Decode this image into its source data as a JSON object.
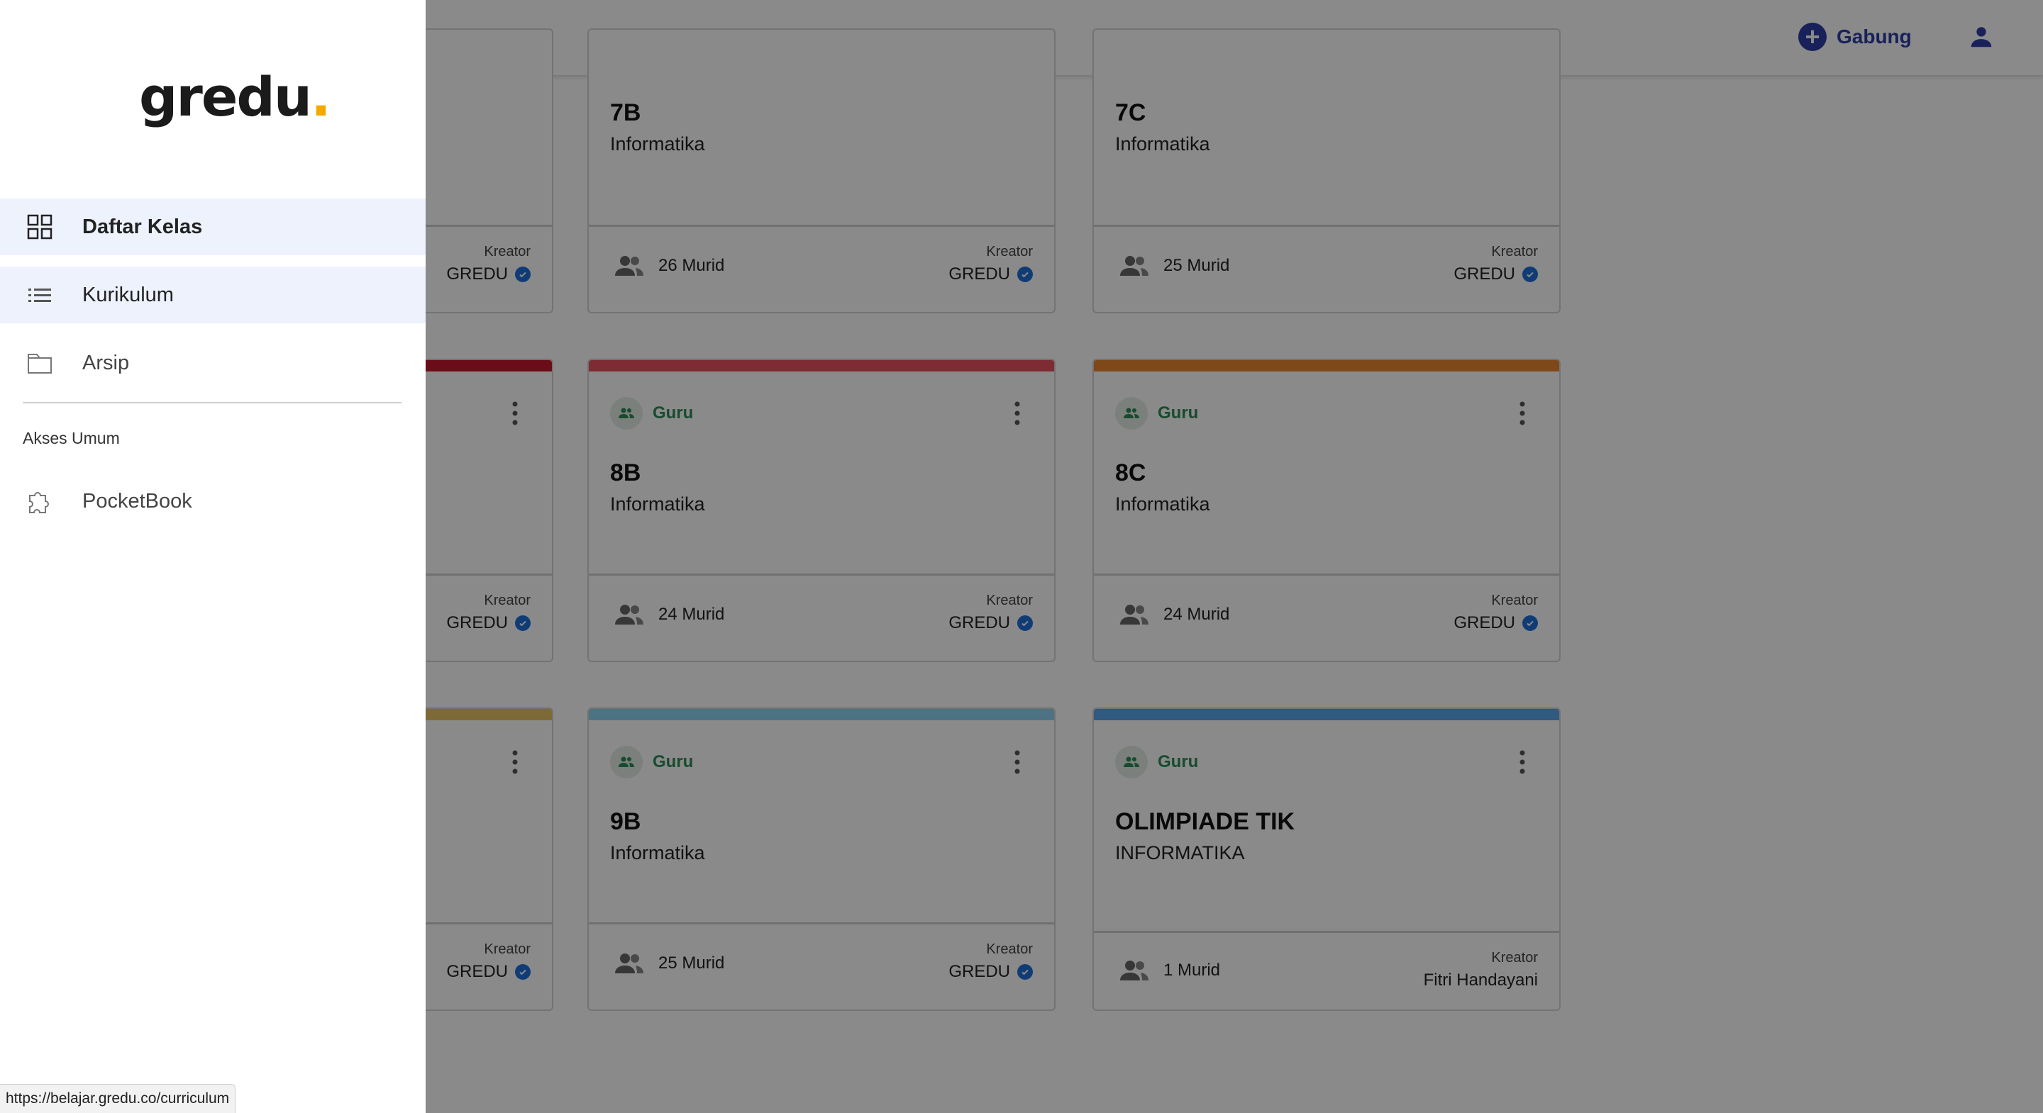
{
  "topbar": {
    "join_label": "Gabung"
  },
  "cards": [
    {
      "title": "",
      "subject": "",
      "students": "",
      "kreator_label": "Kreator",
      "kreator_name": "GREDU"
    },
    {
      "title": "7B",
      "subject": "Informatika",
      "students": "26 Murid",
      "kreator_label": "Kreator",
      "kreator_name": "GREDU"
    },
    {
      "title": "7C",
      "subject": "Informatika",
      "students": "25 Murid",
      "kreator_label": "Kreator",
      "kreator_name": "GREDU"
    },
    {
      "title": "",
      "subject": "",
      "students": "",
      "kreator_label": "Kreator",
      "kreator_name": "GREDU",
      "color": "#c5192d"
    },
    {
      "role": "Guru",
      "title": "8B",
      "subject": "Informatika",
      "students": "24 Murid",
      "kreator_label": "Kreator",
      "kreator_name": "GREDU",
      "color": "#e9505f"
    },
    {
      "role": "Guru",
      "title": "8C",
      "subject": "Informatika",
      "students": "24 Murid",
      "kreator_label": "Kreator",
      "kreator_name": "GREDU",
      "color": "#e9852f"
    },
    {
      "title": "",
      "subject": "",
      "students": "",
      "kreator_label": "Kreator",
      "kreator_name": "GREDU",
      "color": "#e9c467"
    },
    {
      "role": "Guru",
      "title": "9B",
      "subject": "Informatika",
      "students": "25 Murid",
      "kreator_label": "Kreator",
      "kreator_name": "GREDU",
      "color": "#8fd3f2"
    },
    {
      "role": "Guru",
      "title": "OLIMPIADE TIK",
      "subject": "INFORMATIKA",
      "students": "1 Murid",
      "kreator_label": "Kreator",
      "kreator_name": "Fitri Handayani",
      "color": "#5aa7ea"
    }
  ],
  "drawer": {
    "logo": "gredu",
    "logo_dot": ".",
    "nav": [
      {
        "label": "Daftar Kelas",
        "icon": "grid-icon"
      },
      {
        "label": "Kurikulum",
        "icon": "list-icon"
      },
      {
        "label": "Arsip",
        "icon": "folder-icon"
      }
    ],
    "section_label": "Akses Umum",
    "public_nav": [
      {
        "label": "PocketBook",
        "icon": "puzzle-icon"
      }
    ]
  },
  "status_url": "https://belajar.gredu.co/curriculum"
}
